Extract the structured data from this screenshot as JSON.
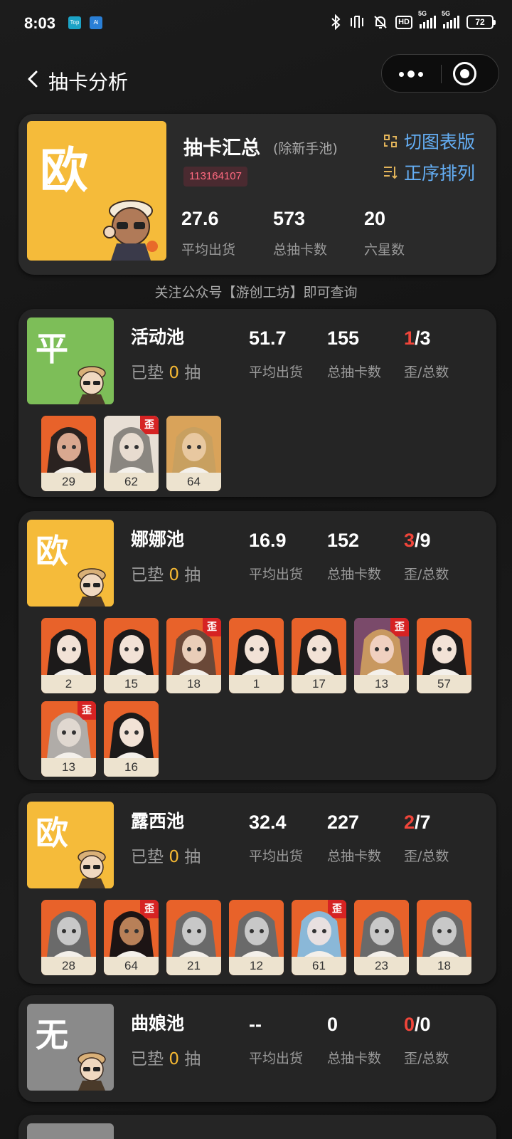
{
  "status_bar": {
    "time": "8:03",
    "app1": "Top",
    "app2": "Ai",
    "battery": "72",
    "hd": "HD",
    "net1": "5G",
    "net2": "5G"
  },
  "nav": {
    "title": "抽卡分析"
  },
  "summary": {
    "grade": "欧",
    "grade_color": "#f5bb3a",
    "title": "抽卡汇总",
    "subtitle": "(除新手池)",
    "uid": "113164107",
    "toggle_view": "切图表版",
    "sort_order": "正序排列",
    "avg": "27.6",
    "avg_label": "平均出货",
    "total": "573",
    "total_label": "总抽卡数",
    "six_star": "20",
    "six_star_label": "六星数"
  },
  "notice": "关注公众号【游创工坊】即可查询",
  "labels": {
    "avg": "平均出货",
    "total": "总抽卡数",
    "loss": "歪/总数",
    "pity_prefix": "已垫",
    "pity_suffix": "抽",
    "loss_tag": "歪"
  },
  "pools": [
    {
      "name": "活动池",
      "grade": "平",
      "grade_color": "#7dbe58",
      "pity": "0",
      "avg": "51.7",
      "total": "155",
      "loss": "1",
      "count": "/3",
      "chars": [
        {
          "n": "29",
          "loss": false,
          "art": "dark"
        },
        {
          "n": "62",
          "loss": true,
          "art": "gray"
        },
        {
          "n": "64",
          "loss": false,
          "art": "blonde"
        }
      ]
    },
    {
      "name": "娜娜池",
      "grade": "欧",
      "grade_color": "#f5bb3a",
      "pity": "0",
      "avg": "16.9",
      "total": "152",
      "loss": "3",
      "count": "/9",
      "chars": [
        {
          "n": "2",
          "loss": false,
          "art": "curly"
        },
        {
          "n": "15",
          "loss": false,
          "art": "curly"
        },
        {
          "n": "18",
          "loss": true,
          "art": "brown"
        },
        {
          "n": "1",
          "loss": false,
          "art": "curly"
        },
        {
          "n": "17",
          "loss": false,
          "art": "curly"
        },
        {
          "n": "13",
          "loss": true,
          "art": "rose"
        },
        {
          "n": "57",
          "loss": false,
          "art": "curly"
        },
        {
          "n": "13",
          "loss": true,
          "art": "silver"
        },
        {
          "n": "16",
          "loss": false,
          "art": "curly"
        }
      ]
    },
    {
      "name": "露西池",
      "grade": "欧",
      "grade_color": "#f5bb3a",
      "pity": "0",
      "avg": "32.4",
      "total": "227",
      "loss": "2",
      "count": "/7",
      "chars": [
        {
          "n": "28",
          "loss": false,
          "art": "knight"
        },
        {
          "n": "64",
          "loss": true,
          "art": "tan"
        },
        {
          "n": "21",
          "loss": false,
          "art": "knight"
        },
        {
          "n": "12",
          "loss": false,
          "art": "knight"
        },
        {
          "n": "61",
          "loss": true,
          "art": "blue"
        },
        {
          "n": "23",
          "loss": false,
          "art": "knight"
        },
        {
          "n": "18",
          "loss": false,
          "art": "knight"
        }
      ]
    },
    {
      "name": "曲娘池",
      "grade": "无",
      "grade_color": "#8a8a8a",
      "pity": "0",
      "avg": "--",
      "total": "0",
      "loss": "0",
      "count": "/0",
      "chars": []
    }
  ]
}
